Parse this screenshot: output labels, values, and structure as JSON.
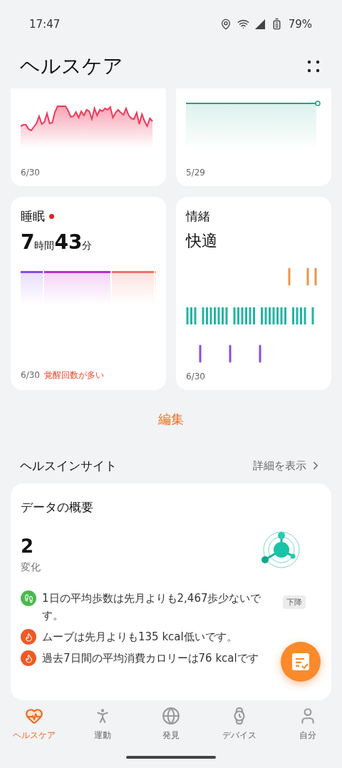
{
  "status_bar": {
    "time": "17:47",
    "battery": "79%"
  },
  "header": {
    "title": "ヘルスケア"
  },
  "top_cards": [
    {
      "kind": "heart",
      "date": "6/30"
    },
    {
      "kind": "weight",
      "date": "5/29"
    }
  ],
  "cards": [
    {
      "kind": "sleep",
      "title": "睡眠",
      "alert": true,
      "value": [
        {
          "text": "7",
          "kind": "number"
        },
        {
          "text": "時間",
          "kind": "unit"
        },
        {
          "text": "43",
          "kind": "number"
        },
        {
          "text": "分",
          "kind": "unit"
        }
      ],
      "date": "6/30",
      "note": "覚醒回数が多い"
    },
    {
      "kind": "mood",
      "title": "情緒",
      "alert": false,
      "value": [
        {
          "text": "快適",
          "kind": "word"
        }
      ],
      "date": "6/30"
    }
  ],
  "edit_button": "編集",
  "insight": {
    "title": "ヘルスインサイト",
    "link": "詳細を表示",
    "card_title": "データの概要",
    "count": "2",
    "count_label": "変化",
    "rows": [
      {
        "kind": "steps",
        "text": "1日の平均歩数は先月よりも2,467歩少ないです。",
        "badge": "下降"
      },
      {
        "kind": "calorie",
        "text": "ムーブは先月よりも135 kcal低いです。"
      },
      {
        "kind": "calorie",
        "text": "過去7日間の平均消費カロリーは76 kcalです"
      }
    ]
  },
  "nav": [
    {
      "kind": "health",
      "label": "ヘルスケア",
      "selected": true
    },
    {
      "kind": "exercise",
      "label": "運動",
      "selected": false
    },
    {
      "kind": "discover",
      "label": "発見",
      "selected": false
    },
    {
      "kind": "devices",
      "label": "デバイス",
      "selected": false
    },
    {
      "kind": "me",
      "label": "自分",
      "selected": false
    }
  ]
}
